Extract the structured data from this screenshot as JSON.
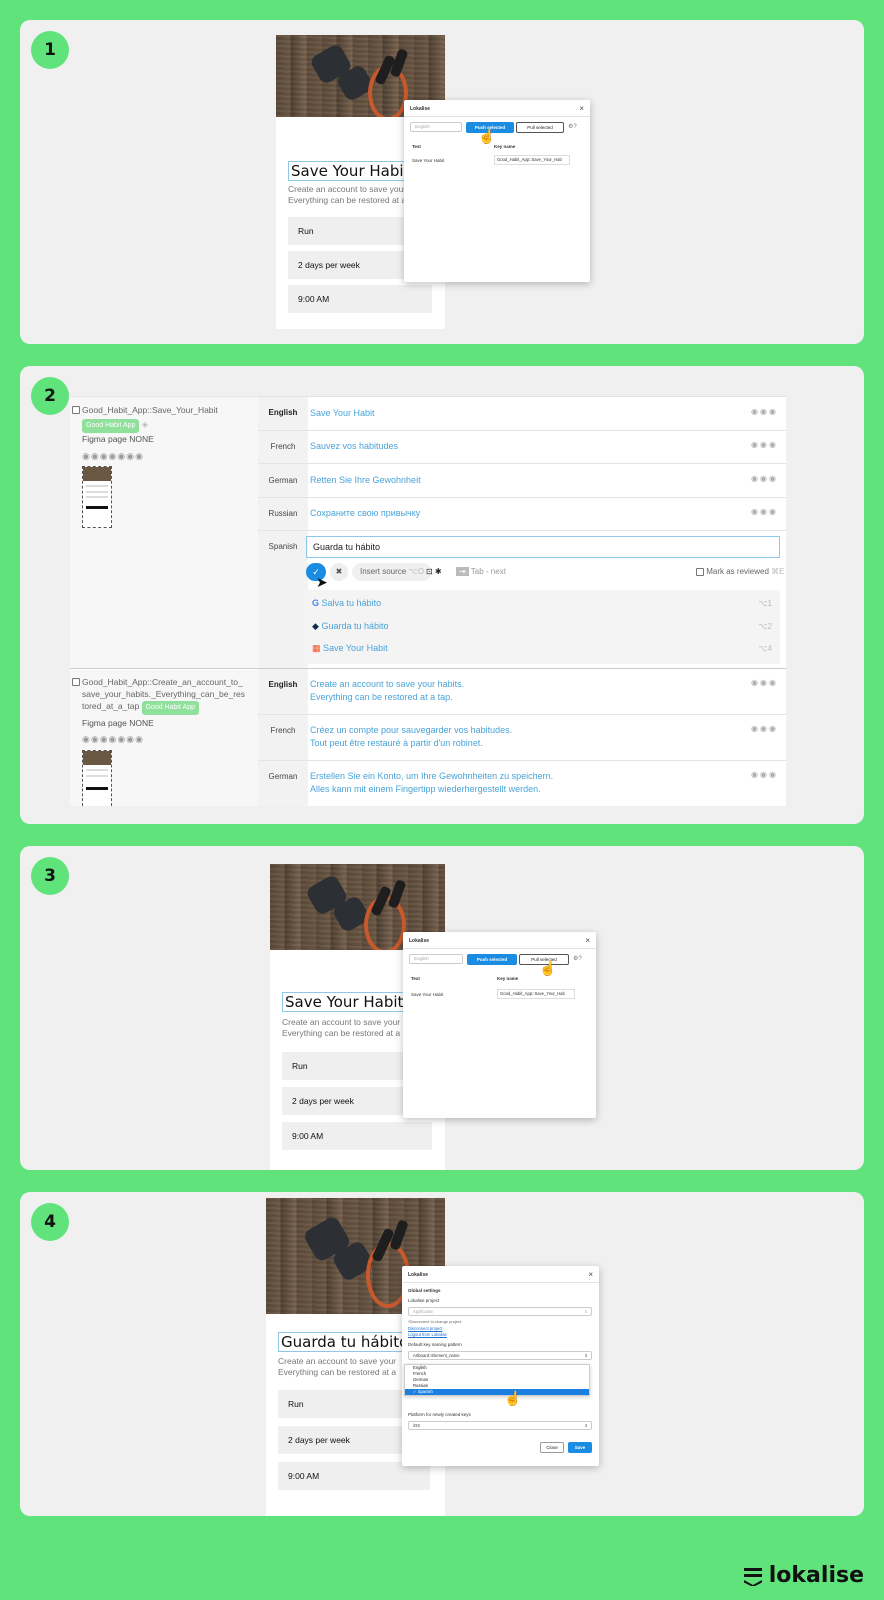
{
  "steps": [
    "1",
    "2",
    "3",
    "4"
  ],
  "mockup": {
    "title_en": "Save Your Habit",
    "title_es": "Guarda tu hábito",
    "subtitle_line1": "Create an account to save your",
    "subtitle_line2": "Everything can be restored at a",
    "rows": [
      "Run",
      "2 days per week",
      "9:00 AM"
    ]
  },
  "plugin": {
    "title": "Lokalise",
    "close": "×",
    "language_placeholder": "English",
    "push_label": "Push selected",
    "pull_label": "Pull selected",
    "col_text": "Text",
    "col_key": "Key name",
    "row_text": "Save Your Habit",
    "row_key": "Good_Habit_App::Save_Your_Hab",
    "row_key_3": "Good_Habit_App::Save_Your_Hab"
  },
  "editor": {
    "key1": "Good_Habit_App::Save_Your_Habit",
    "tag": "Good Habit App",
    "figma_page": "Figma page NONE",
    "key2_line1": "Good_Habit_App::Create_an_account_to_",
    "key2_line2": "save_your_habits._Everything_can_be_res",
    "key2_line3": "tored_at_a_tap",
    "langs": [
      "English",
      "French",
      "German",
      "Russian",
      "Spanish"
    ],
    "translations": {
      "english": "Save Your Habit",
      "french": "Sauvez vos habitudes",
      "german": "Retten Sie Ihre Gewohnheit",
      "russian": "Сохраните свою привычку",
      "spanish": "Guarda tu hábito"
    },
    "toolbar": {
      "insert_source": "Insert source",
      "insert_shortcut": "⌥O",
      "tab_hint": "Tab - next",
      "tab_key": "⇥",
      "mark_reviewed": "Mark as reviewed",
      "mark_shortcut": "⌘E"
    },
    "suggestions": [
      {
        "text": "Salva tu hábito",
        "shortcut": "⌥1",
        "provider": "google"
      },
      {
        "text": "Guarda tu hábito",
        "shortcut": "⌥2",
        "provider": "deepl"
      },
      {
        "text": "Save Your Habit",
        "shortcut": "⌥4",
        "provider": "microsoft"
      }
    ],
    "translations2": {
      "english_l1": "Create an account to save your habits.",
      "english_l2": "Everything can be restored at a tap.",
      "french_l1": "Créez un compte pour sauvegarder vos habitudes.",
      "french_l2": "Tout peut être restauré à partir d'un robinet.",
      "german_l1": "Erstellen Sie ein Konto, um Ihre Gewohnheiten zu speichern.",
      "german_l2": "Alles kann mit einem Fingertipp wiederhergestellt werden."
    }
  },
  "settings": {
    "title": "Lokalise",
    "heading": "Global settings",
    "project_label": "Lokalise project",
    "project_value": "Application",
    "disconnect_note": "*Disconnect to change project",
    "disconnect_link": "Disconnect project",
    "logout_link": "Logout from Lokalise",
    "pattern_label": "Default key naming pattern",
    "pattern_value": "Artboard::Element_name",
    "languages": [
      "English",
      "French",
      "German",
      "Russian",
      "Spanish"
    ],
    "selected_language": "Spanish",
    "platform_label": "Platform for newly created keys",
    "platform_value": "iOS",
    "close_label": "Close",
    "save_label": "Save"
  },
  "brand": {
    "name": "lokalise"
  },
  "colors": {
    "accent": "#5fe37a",
    "primary_button": "#1a8de3",
    "link_text": "#4aa3d8"
  }
}
